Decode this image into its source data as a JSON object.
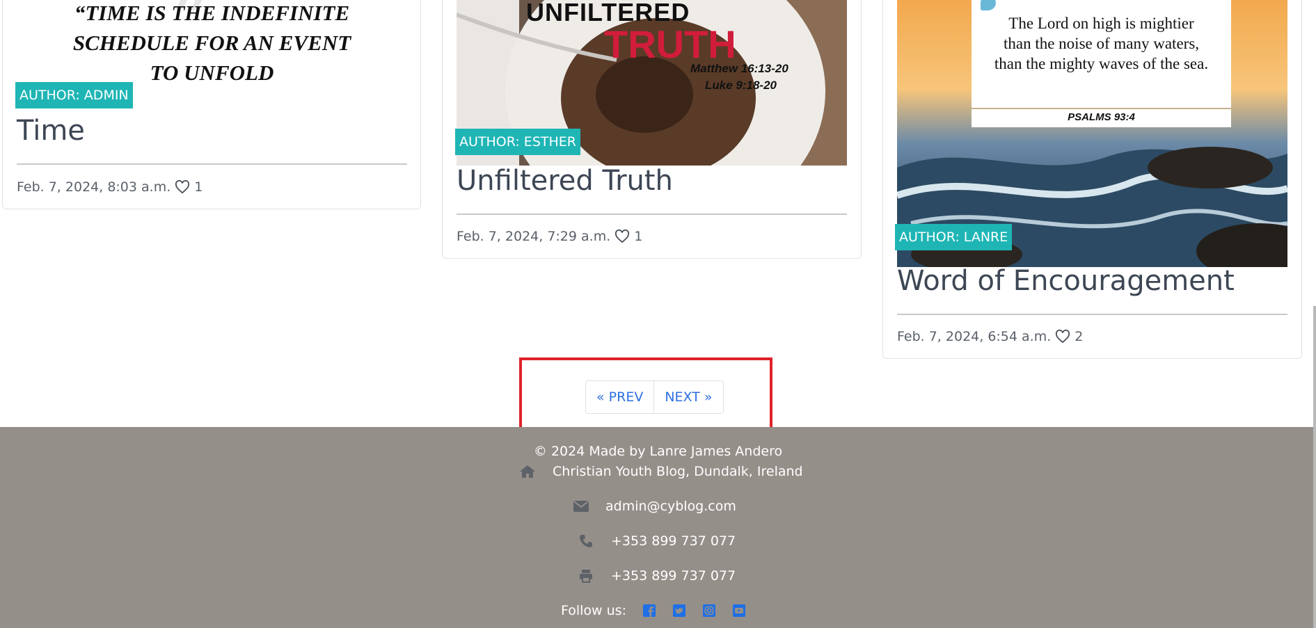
{
  "posts": [
    {
      "image_lines": [
        "“TIME IS THE INDEFINITE",
        "SCHEDULE FOR AN EVENT",
        "TO UNFOLD"
      ],
      "author_badge": "AUTHOR: ADMIN",
      "title": "Time",
      "date": "Feb. 7, 2024, 8:03 a.m.",
      "likes": "1"
    },
    {
      "image_lines": [
        "UNFILTERED",
        "TRUTH",
        "Matthew 16:13-20",
        "Luke 9:18-20"
      ],
      "author_badge": "AUTHOR: ESTHER",
      "title": "Unfiltered Truth",
      "date": "Feb. 7, 2024, 7:29 a.m.",
      "likes": "1"
    },
    {
      "image_lines": [
        "The Lord on high is mightier",
        "than the noise of many waters,",
        "than the mighty waves of the sea.",
        "PSALMS 93:4"
      ],
      "author_badge": "AUTHOR: LANRE",
      "title": "Word of Encouragement",
      "date": "Feb. 7, 2024, 6:54 a.m.",
      "likes": "2"
    }
  ],
  "pagination": {
    "prev": "« PREV",
    "next": "NEXT »"
  },
  "footer": {
    "copyright": "© 2024 Made by Lanre James Andero",
    "address": "Christian Youth Blog, Dundalk, Ireland",
    "email": "admin@cyblog.com",
    "phone": "+353 899 737 077",
    "fax": "+353 899 737 077",
    "follow_label": "Follow us:",
    "icons": [
      "home-icon",
      "envelope-icon",
      "phone-icon",
      "print-icon"
    ],
    "social": [
      "facebook-icon",
      "twitter-icon",
      "instagram-icon",
      "youtube-icon"
    ]
  },
  "colors": {
    "badge": "#1fb5b5",
    "link": "#2f6fe0",
    "footer_bg": "#958f8a",
    "highlight": "#e0212a"
  }
}
